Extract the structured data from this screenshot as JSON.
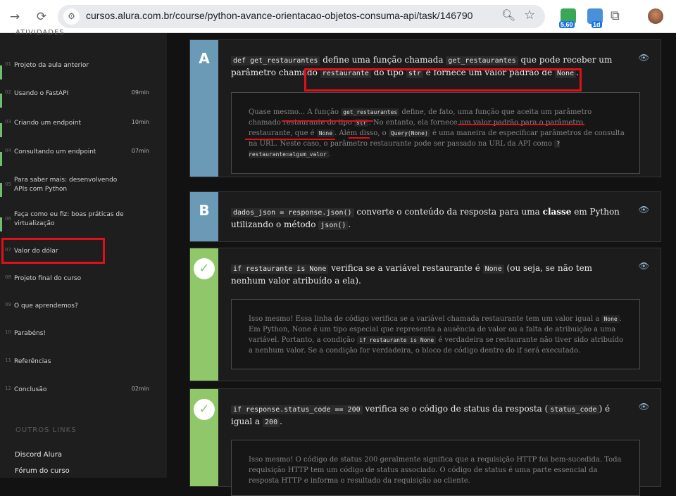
{
  "browser": {
    "url": "cursos.alura.com.br/course/python-avance-orientacao-objetos-consuma-api/task/146790",
    "ext1_badge": "5,60",
    "ext2_badge": "1d"
  },
  "sidebar": {
    "heading": "ATIVIDADES",
    "items": [
      {
        "num": "01",
        "label": "Projeto da aula anterior",
        "duration": ""
      },
      {
        "num": "02",
        "label": "Usando o FastAPI",
        "duration": "09min"
      },
      {
        "num": "03",
        "label": "Criando um endpoint",
        "duration": "10min"
      },
      {
        "num": "04",
        "label": "Consultando um endpoint",
        "duration": "07min"
      },
      {
        "num": "05",
        "label": "Para saber mais: desenvolvendo APIs com Python",
        "duration": ""
      },
      {
        "num": "06",
        "label": "Faça como eu fiz: boas práticas de virtualização",
        "duration": ""
      },
      {
        "num": "07",
        "label": "Valor do dólar",
        "duration": ""
      },
      {
        "num": "08",
        "label": "Projeto final do curso",
        "duration": ""
      },
      {
        "num": "09",
        "label": "O que aprendemos?",
        "duration": ""
      },
      {
        "num": "10",
        "label": "Parabéns!",
        "duration": ""
      },
      {
        "num": "11",
        "label": "Referências",
        "duration": ""
      },
      {
        "num": "12",
        "label": "Conclusão",
        "duration": "02min"
      }
    ],
    "other_links_heading": "OUTROS LINKS",
    "links": [
      "Discord Alura",
      "Fórum do curso"
    ]
  },
  "cards": {
    "a": {
      "letter": "A",
      "code1": "def get_restaurantes",
      "t1": " define uma função chamada ",
      "code2": "get_restaurantes",
      "t2": " que pode receber um parâmetro chamado ",
      "code3": "restaurante",
      "t3": " do tipo ",
      "code4": "str",
      "t4": " e fornece um valor padrão de ",
      "code5": "None",
      "t5": ".",
      "fb_t1": "Quase mesmo... A função ",
      "fb_c1": "get_restaurantes",
      "fb_t2": " define, de fato, uma função que aceita um parâmetro chamado restaurante do tipo ",
      "fb_c2": "str",
      "fb_t3": ". No entanto, ela fornece um valor padrão para o parâmetro restaurante, que é ",
      "fb_c3": "None",
      "fb_t4": ". Além disso, o ",
      "fb_c4": "Query(None)",
      "fb_t5": " é uma maneira de especificar parâmetros de consulta na URL. Neste caso, o parâmetro restaurante pode ser passado na URL da API como ",
      "fb_c5": "?restaurante=algum_valor",
      "fb_t6": "."
    },
    "b": {
      "letter": "B",
      "code1": "dados_json = response.json()",
      "t1": " converte o conteúdo da resposta para uma ",
      "bold": "classe",
      "t2": " em Python utilizando o método ",
      "code2": "json()",
      "t3": "."
    },
    "c": {
      "code1": "if restaurante is None",
      "t1": " verifica se a variável restaurante é ",
      "code2": "None",
      "t2": " (ou seja, se não tem nenhum valor atribuído a ela).",
      "fb_t1": "Isso mesmo! Essa linha de código verifica se a variável chamada restaurante tem um valor igual a ",
      "fb_c1": "None",
      "fb_t2": ". Em Python, None é um tipo especial que representa a ausência de valor ou a falta de atribuição a uma variável. Portanto, a condição ",
      "fb_c2": "if restaurante is None",
      "fb_t3": " é verdadeira se restaurante não tiver sido atribuído a nenhum valor. Se a condição for verdadeira, o bloco de código dentro do if será executado."
    },
    "d": {
      "code1": "if response.status_code == 200",
      "t1": " verifica se o código de status da resposta (",
      "code2": "status_code",
      "t2": ") é igual a ",
      "code3": "200",
      "t3": ".",
      "fb_t1": "Isso mesmo! O código de status 200 geralmente significa que a requisição HTTP foi bem-sucedida. Toda requisição HTTP tem um código de status associado. O código de status é uma parte essencial da resposta HTTP e informa o resultado da requisição ao cliente."
    }
  },
  "colors": {
    "letter_col": "#6a9ab5",
    "correct_col": "#8fc76a",
    "annotation": "#e0101a"
  }
}
